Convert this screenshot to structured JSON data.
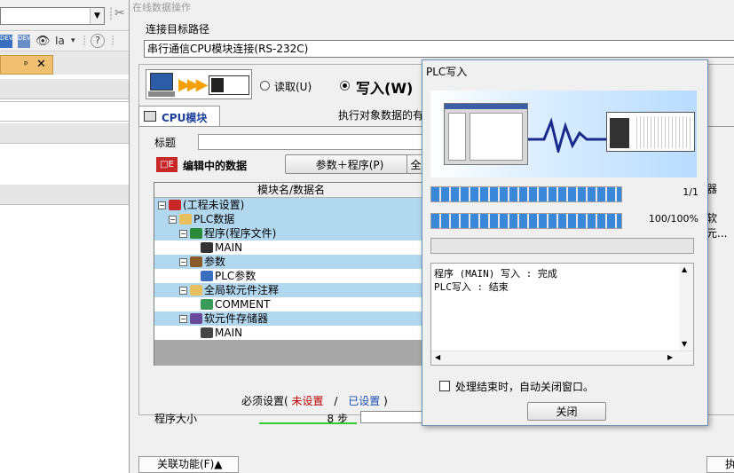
{
  "left_panel": {
    "toolbar_icons": [
      "dev-icon",
      "dev-icon",
      "watch-icon",
      "find-icon",
      "help-icon"
    ],
    "pin_icon": "pin-icon",
    "close_glyph": "✕",
    "pin_glyph": "ᵖ"
  },
  "main": {
    "window_title": "在线数据操作",
    "route_label": "连接目标路径",
    "route_value": "串行通信CPU模块连接(RS-232C)",
    "read_label": "读取(U)",
    "write_label": "写入(W)",
    "tab_cpu": "CPU模块",
    "target_text": "执行对象数据的有",
    "title_label": "标题",
    "editing_label": "编辑中的数据",
    "param_prog_btn": "参数＋程序(P)",
    "all_btn": "全",
    "tree_header": "模块名/数据名",
    "tree": [
      {
        "label": "(工程未设置)",
        "icon": "project-icon",
        "toggle": "−"
      },
      {
        "label": "PLC数据",
        "icon": "folder-icon",
        "toggle": "−"
      },
      {
        "label": "程序(程序文件)",
        "icon": "program-icon",
        "toggle": "−"
      },
      {
        "label": "MAIN",
        "icon": "program-file-icon",
        "toggle": ""
      },
      {
        "label": "参数",
        "icon": "parameter-icon",
        "toggle": "−"
      },
      {
        "label": "PLC参数",
        "icon": "plc-parameter-icon",
        "toggle": ""
      },
      {
        "label": "全局软元件注释",
        "icon": "folder-icon",
        "toggle": "−"
      },
      {
        "label": "COMMENT",
        "icon": "comment-icon",
        "toggle": ""
      },
      {
        "label": "软元件存储器",
        "icon": "device-memory-icon",
        "toggle": "−"
      },
      {
        "label": "MAIN",
        "icon": "device-file-icon",
        "toggle": ""
      }
    ],
    "required_prefix": "必须设置(",
    "required_unset": "未设置",
    "required_sep": "/",
    "required_set": "已设置",
    "required_suffix": ")",
    "program_size_label": "程序大小",
    "program_size_value": "8 步",
    "related_btn": "关联功能(F)▲",
    "right_col_header": "器",
    "right_col_cell": "软元...",
    "bottom_right_text": "执"
  },
  "popup": {
    "title": "PLC写入",
    "progress1_value": 1.0,
    "progress1_text": "1/1",
    "progress2_value": 1.0,
    "progress2_text": "100/100%",
    "log_lines": [
      "程序 (MAIN) 写入 : 完成",
      "PLC写入 : 结束"
    ],
    "auto_close_checked": false,
    "auto_close_label": "处理结束时，自动关闭窗口。",
    "close_btn": "关闭"
  },
  "colors": {
    "selection": "#b2d8f0",
    "progress": "#3a86d8",
    "unset_red": "#c00000",
    "set_blue": "#1a4fb0",
    "size_bar": "#33cc33"
  }
}
